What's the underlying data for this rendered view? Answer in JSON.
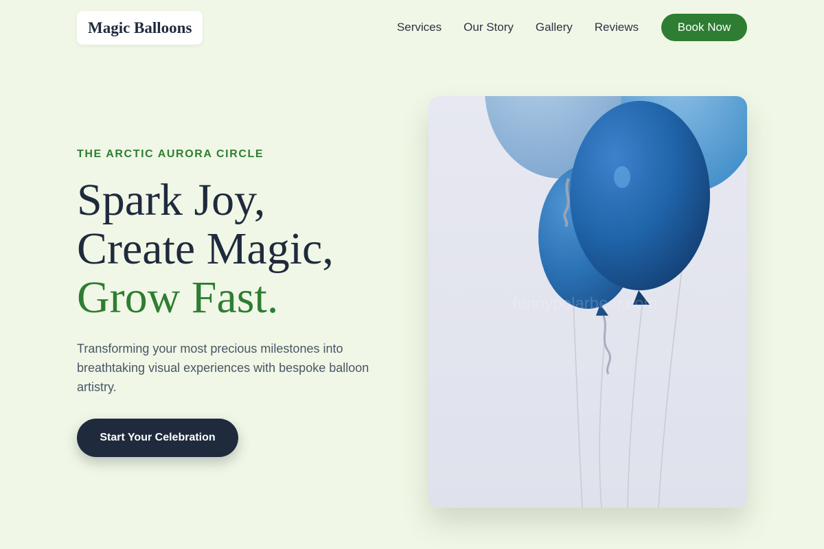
{
  "header": {
    "logo": "Magic Balloons",
    "nav": [
      "Services",
      "Our Story",
      "Gallery",
      "Reviews"
    ],
    "book_label": "Book Now"
  },
  "hero": {
    "eyebrow": "THE ARCTIC AURORA CIRCLE",
    "headline_line1": "Spark Joy,",
    "headline_line2": "Create Magic,",
    "headline_line3": "Grow Fast.",
    "lead": "Transforming your most precious milestones into breathtaking visual experiences with bespoke balloon artistry.",
    "cta_label": "Start Your Celebration",
    "image_watermark": "funnypolarbear.com"
  },
  "colors": {
    "background": "#f0f7e6",
    "accent_green": "#2e7d32",
    "dark_navy": "#1f2a3d",
    "balloon_blue": "#1f63a8"
  },
  "icons": {
    "hero_image": "blue-balloons-photo"
  }
}
